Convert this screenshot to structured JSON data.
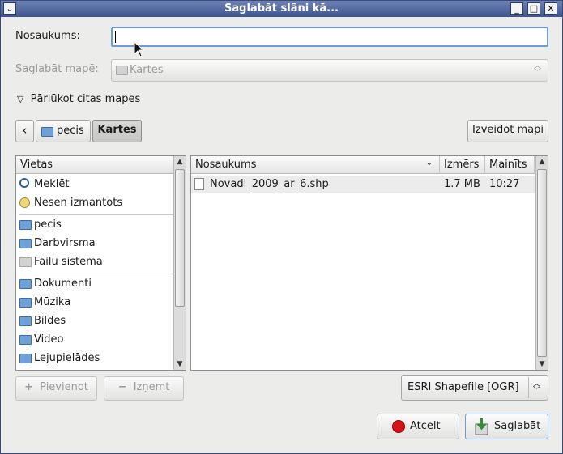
{
  "window": {
    "title": "Saglabāt slāni kā..."
  },
  "form": {
    "name_label": "Nosaukums:",
    "name_value": "",
    "save_in_label": "Saglabāt mapē:",
    "save_in_value": "Kartes",
    "browse_label": "Pārlūkot citas mapes"
  },
  "path_bar": {
    "back": "‹",
    "crumbs": [
      "pecis",
      "Kartes"
    ],
    "create_folder": "Izveidot mapi"
  },
  "places": {
    "header": "Vietas",
    "groups": [
      [
        {
          "label": "Meklēt",
          "icon": "search-icon"
        },
        {
          "label": "Nesen izmantots",
          "icon": "recent-icon"
        }
      ],
      [
        {
          "label": "pecis",
          "icon": "home-folder-icon"
        },
        {
          "label": "Darbvirsma",
          "icon": "desktop-folder-icon"
        },
        {
          "label": "Failu sistēma",
          "icon": "drive-icon"
        }
      ],
      [
        {
          "label": "Dokumenti",
          "icon": "folder-icon"
        },
        {
          "label": "Mūzika",
          "icon": "music-folder-icon"
        },
        {
          "label": "Bildes",
          "icon": "pictures-folder-icon"
        },
        {
          "label": "Video",
          "icon": "video-folder-icon"
        },
        {
          "label": "Lejupielādes",
          "icon": "downloads-folder-icon"
        }
      ]
    ],
    "add_button": "Pievienot",
    "remove_button": "Izņemt"
  },
  "files": {
    "columns": {
      "name": "Nosaukums",
      "size": "Izmērs",
      "modified": "Mainīts"
    },
    "rows": [
      {
        "name": "Novadi_2009_ar_6.shp",
        "size": "1.7 MB",
        "modified": "10:27",
        "icon": "file-icon"
      }
    ]
  },
  "filter": {
    "value": "ESRI Shapefile [OGR]"
  },
  "actions": {
    "cancel": "Atcelt",
    "save": "Saglabāt"
  },
  "colors": {
    "titlebar": "#4a5f98",
    "accent_focus": "#5b87c6",
    "cancel_red": "#d4141a"
  }
}
